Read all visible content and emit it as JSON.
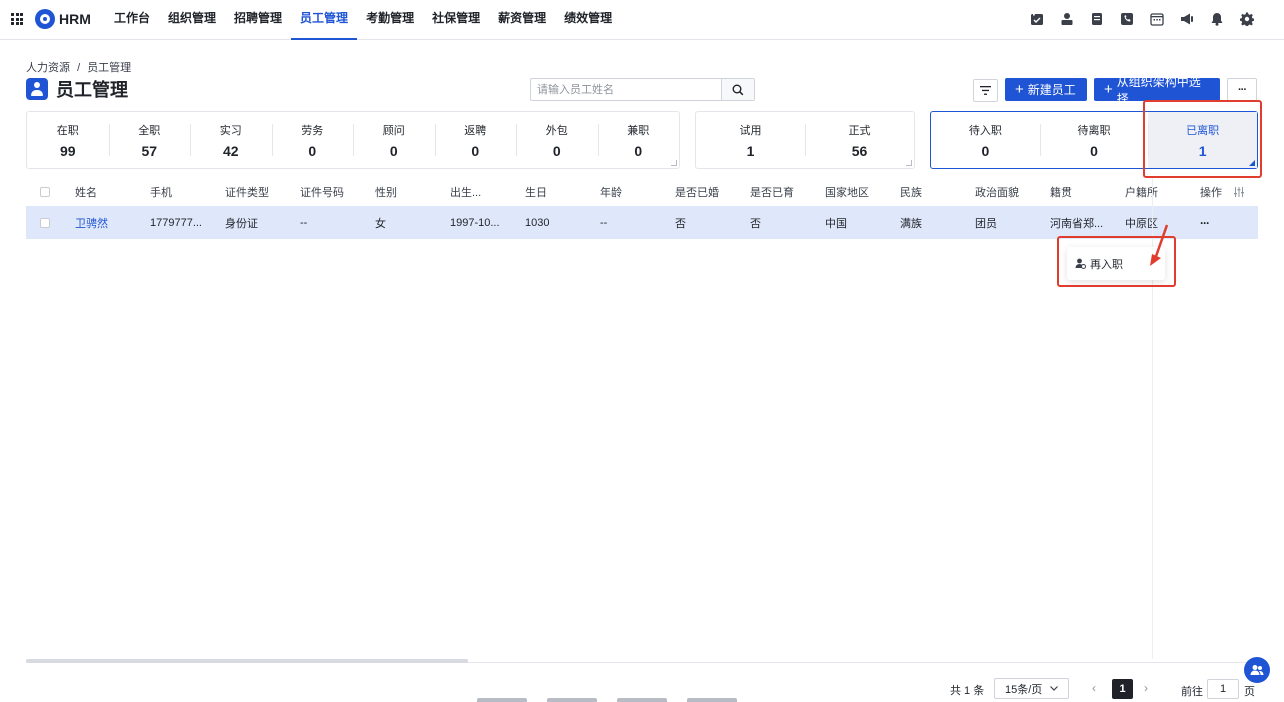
{
  "app": {
    "brand": "HRM"
  },
  "nav": [
    "工作台",
    "组织管理",
    "招聘管理",
    "员工管理",
    "考勤管理",
    "社保管理",
    "薪资管理",
    "绩效管理"
  ],
  "nav_active_index": 3,
  "top_icons": [
    "calendar-check-icon",
    "user-icon",
    "document-icon",
    "phone-icon",
    "calendar-icon",
    "megaphone-icon",
    "bell-icon",
    "gear-icon"
  ],
  "breadcrumb": {
    "root": "人力资源",
    "sep": "/",
    "current": "员工管理"
  },
  "page": {
    "title": "员工管理"
  },
  "search": {
    "placeholder": "请输入员工姓名",
    "value": ""
  },
  "toolbar": {
    "new_label": "新建员工",
    "org_label": "从组织架构中选择",
    "more_label": "···"
  },
  "stats": {
    "group1": [
      {
        "label": "在职",
        "value": "99"
      },
      {
        "label": "全职",
        "value": "57"
      },
      {
        "label": "实习",
        "value": "42"
      },
      {
        "label": "劳务",
        "value": "0"
      },
      {
        "label": "顾问",
        "value": "0"
      },
      {
        "label": "返聘",
        "value": "0"
      },
      {
        "label": "外包",
        "value": "0"
      },
      {
        "label": "兼职",
        "value": "0"
      }
    ],
    "group2": [
      {
        "label": "试用",
        "value": "1"
      },
      {
        "label": "正式",
        "value": "56"
      }
    ],
    "group3": [
      {
        "label": "待入职",
        "value": "0"
      },
      {
        "label": "待离职",
        "value": "0"
      },
      {
        "label": "已离职",
        "value": "1"
      }
    ],
    "active": "已离职"
  },
  "table": {
    "headers": [
      "姓名",
      "手机",
      "证件类型",
      "证件号码",
      "性别",
      "出生...",
      "生日",
      "年龄",
      "是否已婚",
      "是否已育",
      "国家地区",
      "民族",
      "政治面貌",
      "籍贯",
      "户籍所",
      "操作"
    ],
    "rows": [
      [
        "卫骋然",
        "1779777...",
        "身份证",
        "--",
        "女",
        "1997-10...",
        "1030",
        "--",
        "否",
        "否",
        "中国",
        "满族",
        "团员",
        "河南省郑...",
        "中原区",
        "···"
      ]
    ]
  },
  "dropdown": {
    "item": "再入职"
  },
  "pagination": {
    "total": "共 1 条",
    "page_size": "15条/页",
    "current": "1",
    "goto_label": "前往",
    "goto_value": "1",
    "goto_unit": "页"
  },
  "colors": {
    "primary": "#1f55d5",
    "annotation": "#e03d2f",
    "row_highlight": "#dfe8fa"
  }
}
